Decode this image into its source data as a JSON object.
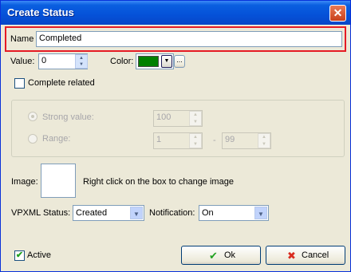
{
  "window": {
    "title": "Create Status",
    "close_glyph": "✕"
  },
  "name": {
    "label": "Name",
    "value": "Completed",
    "highlight_color": "#e51b24"
  },
  "value_field": {
    "label": "Value:",
    "value": "0"
  },
  "color_field": {
    "label": "Color:",
    "swatch": "#008000",
    "more_glyph": "..."
  },
  "complete_related": {
    "label": "Complete related",
    "checked": false
  },
  "strong_value": {
    "label": "Strong value:",
    "value": "100",
    "selected": true
  },
  "range": {
    "label": "Range:",
    "from": "1",
    "separator": "-",
    "to": "99"
  },
  "image": {
    "label": "Image:",
    "hint": "Right click on the box to  change image"
  },
  "vpxml": {
    "label": "VPXML Status:",
    "value": "Created"
  },
  "notification": {
    "label": "Notification:",
    "value": "On"
  },
  "active": {
    "label": "Active",
    "checked": true
  },
  "buttons": {
    "ok": "Ok",
    "cancel": "Cancel"
  },
  "icons": {
    "ok_icon": "check-icon",
    "cancel_icon": "cross-icon",
    "check_glyph": "✔",
    "cross_glyph": "✖",
    "up_glyph": "▲",
    "down_glyph": "▼"
  }
}
